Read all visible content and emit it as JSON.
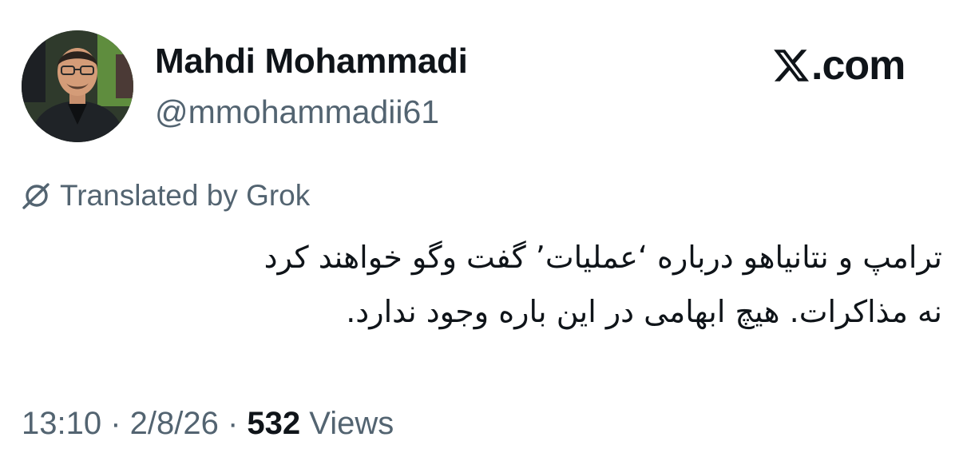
{
  "author": {
    "display_name": "Mahdi Mohammadi",
    "handle": "@mmohammadii61",
    "avatar_icon": "profile-photo"
  },
  "brand": {
    "text": ".com",
    "logo_icon": "x-logo-icon"
  },
  "translation": {
    "label": "Translated by Grok",
    "icon": "grok-icon"
  },
  "tweet": {
    "lines": [
      "ترامپ و نتانیاهو درباره ‘عملیات’ گفت وگو خواهند کرد",
      "نه مذاکرات. هیچ ابهامی در این باره وجود ندارد."
    ]
  },
  "meta": {
    "time": "13:10",
    "separator": " · ",
    "date": "2/8/26",
    "views_count": "532",
    "views_label": " Views"
  },
  "colors": {
    "primary_text": "#0f1419",
    "secondary_text": "#536471",
    "background": "#ffffff"
  }
}
